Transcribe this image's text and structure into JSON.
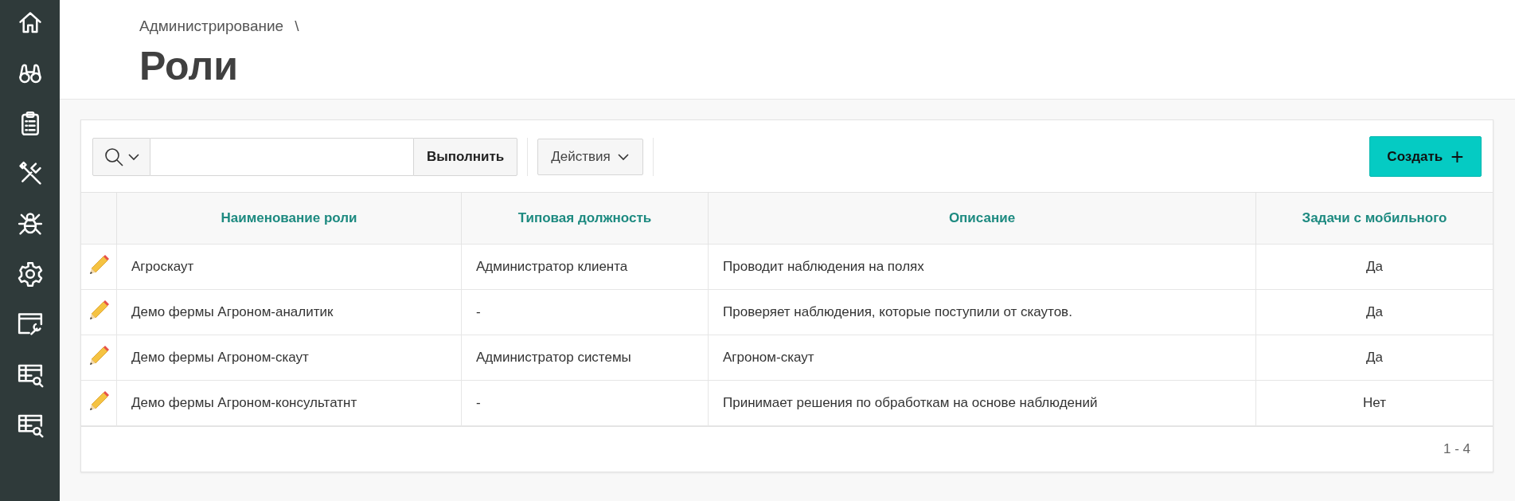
{
  "sidebar": {
    "items": [
      {
        "kind": "home"
      },
      {
        "kind": "binoculars"
      },
      {
        "kind": "clipboard"
      },
      {
        "kind": "tools"
      },
      {
        "kind": "bug"
      },
      {
        "kind": "gear"
      },
      {
        "kind": "window-wrench"
      },
      {
        "kind": "table-search"
      },
      {
        "kind": "table-search"
      }
    ]
  },
  "breadcrumb": [
    "Администрирование",
    "\\"
  ],
  "page_title": "Роли",
  "toolbar": {
    "go_button": "Выполнить",
    "actions_button": "Действия",
    "create_button": "Создать",
    "create_icon": "+"
  },
  "table": {
    "columns": [
      "Наименование роли",
      "Типовая должность",
      "Описание",
      "Задачи с мобильного"
    ],
    "rows": [
      {
        "cells": [
          "Агроскаут",
          "Администратор клиента",
          "Проводит наблюдения на полях",
          "Да"
        ]
      },
      {
        "cells": [
          "Демо фермы Агроном-аналитик",
          "-",
          "Проверяет наблюдения, которые поступили от скаутов.",
          "Да"
        ]
      },
      {
        "cells": [
          "Демо фермы Агроном-скаут",
          "Администратор системы",
          "Агроном-скаут",
          "Да"
        ]
      },
      {
        "cells": [
          "Демо фермы Агроном-консультатнт",
          "-",
          "Принимает решения по обработкам на основе наблюдений",
          "Нет"
        ]
      }
    ]
  },
  "pagination": "1 - 4"
}
